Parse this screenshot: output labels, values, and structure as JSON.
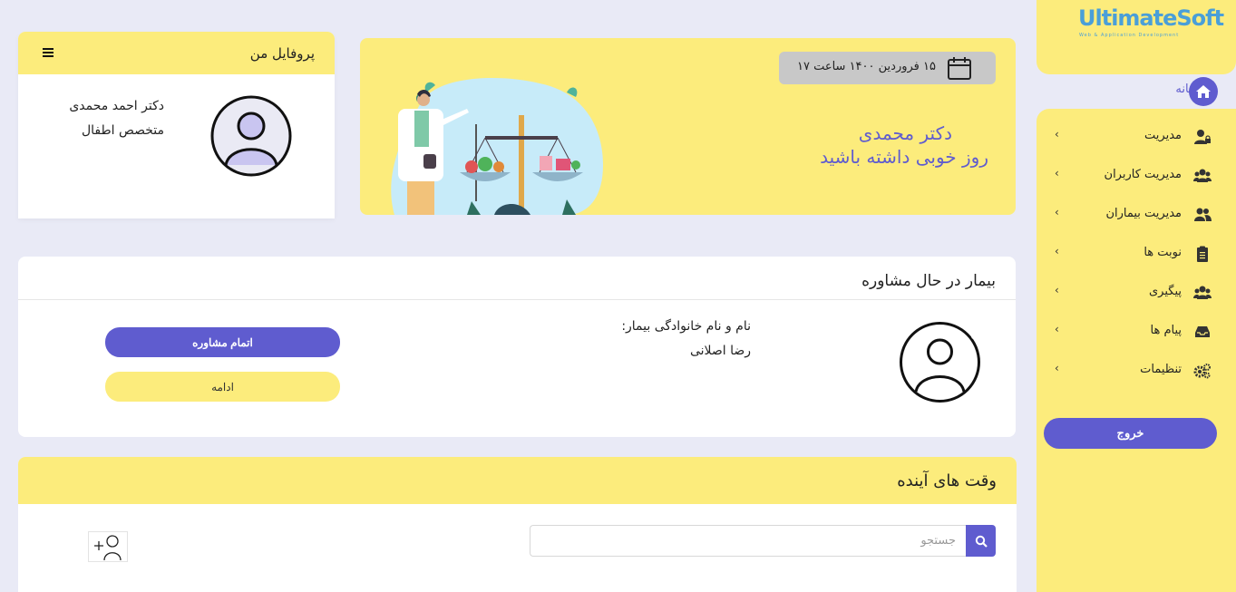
{
  "sidebar": {
    "logo": {
      "title": "UltimateSoft",
      "subtitle": "Web & Application Development"
    },
    "home_label": "خانه",
    "items": [
      {
        "label": "مدیریت",
        "icon": "user-lock-icon"
      },
      {
        "label": "مدیریت کاربران",
        "icon": "users-icon"
      },
      {
        "label": "مدیریت بیماران",
        "icon": "user-group-icon"
      },
      {
        "label": "نوبت ها",
        "icon": "clipboard-icon"
      },
      {
        "label": "پیگیری",
        "icon": "users-icon"
      },
      {
        "label": "پیام ها",
        "icon": "inbox-icon"
      },
      {
        "label": "تنظیمات",
        "icon": "gears-icon"
      }
    ],
    "logout_label": "خروج"
  },
  "welcome": {
    "date_text": "۱۵ فروردین ۱۴۰۰ ساعت ۱۷",
    "greeting_name": "دکتر محمدی",
    "greeting_message": "روز خوبی داشته باشید"
  },
  "profile": {
    "title": "پروفایل من",
    "doctor_name": "دکتر احمد محمدی",
    "specialty": "متخصص اطفال"
  },
  "consult": {
    "title": "بیمار در حال مشاوره",
    "patient_label": "نام و نام خانوادگی بیمار:",
    "patient_name": "رضا اصلانی",
    "finish_label": "اتمام مشاوره",
    "continue_label": "ادامه"
  },
  "upcoming": {
    "title": "وقت های آینده",
    "search_placeholder": "جستجو"
  },
  "colors": {
    "accent": "#5f5ccf",
    "yellow": "#fcec7c",
    "background": "#e9eaf6"
  }
}
